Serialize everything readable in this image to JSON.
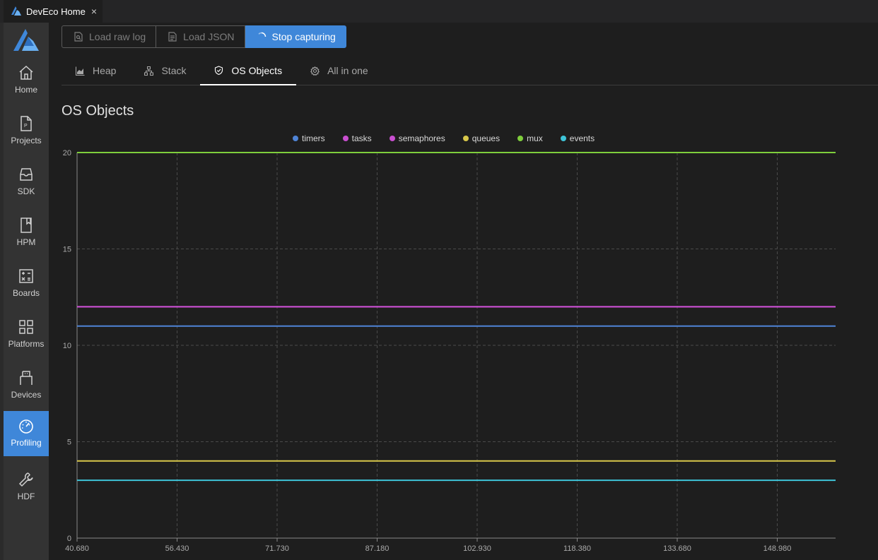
{
  "window_tab": {
    "title": "DevEco Home",
    "close": "×"
  },
  "sidebar": {
    "items": [
      {
        "label": "Home",
        "icon": "home-icon",
        "active": false
      },
      {
        "label": "Projects",
        "icon": "project-file-icon",
        "active": false
      },
      {
        "label": "SDK",
        "icon": "inbox-icon",
        "active": false
      },
      {
        "label": "HPM",
        "icon": "bookmark-icon",
        "active": false
      },
      {
        "label": "Boards",
        "icon": "calculator-icon",
        "active": false
      },
      {
        "label": "Platforms",
        "icon": "grid-icon",
        "active": false
      },
      {
        "label": "Devices",
        "icon": "usb-icon",
        "active": false
      },
      {
        "label": "Profiling",
        "icon": "speedometer-icon",
        "active": true
      },
      {
        "label": "HDF",
        "icon": "wrench-icon",
        "active": false
      }
    ]
  },
  "toolbar": {
    "load_raw_log": "Load raw log",
    "load_json": "Load JSON",
    "stop_capturing": "Stop capturing"
  },
  "tabs": [
    {
      "label": "Heap",
      "icon": "area-chart-icon",
      "active": false
    },
    {
      "label": "Stack",
      "icon": "hierarchy-icon",
      "active": false
    },
    {
      "label": "OS Objects",
      "icon": "shield-check-icon",
      "active": true
    },
    {
      "label": "All in one",
      "icon": "gear-icon",
      "active": false
    }
  ],
  "section_title": "OS Objects",
  "colors": {
    "accent": "#3f87d9",
    "sidebar_bg": "#333333",
    "main_bg": "#1e1e1e"
  },
  "chart_data": {
    "type": "line",
    "title": "",
    "xlabel": "",
    "ylabel": "",
    "x_ticks": [
      "40.680",
      "56.430",
      "71.730",
      "87.180",
      "102.930",
      "118.380",
      "133.680",
      "148.980"
    ],
    "x_range": [
      40.68,
      160.2
    ],
    "ylim": [
      0,
      20
    ],
    "y_ticks": [
      0,
      5,
      10,
      15,
      20
    ],
    "grid": true,
    "legend_position": "top-center",
    "series": [
      {
        "name": "timers",
        "color": "#4f84d6",
        "values": [
          11,
          11
        ]
      },
      {
        "name": "tasks",
        "color": "#c94fd0",
        "values": [
          12,
          12
        ]
      },
      {
        "name": "semaphores",
        "color": "#c94fd0",
        "values": [
          12,
          12
        ]
      },
      {
        "name": "queues",
        "color": "#d8c74a",
        "values": [
          4,
          4
        ]
      },
      {
        "name": "mux",
        "color": "#7fce3c",
        "values": [
          20,
          20
        ]
      },
      {
        "name": "events",
        "color": "#3ec4d8",
        "values": [
          3,
          3
        ]
      }
    ]
  }
}
